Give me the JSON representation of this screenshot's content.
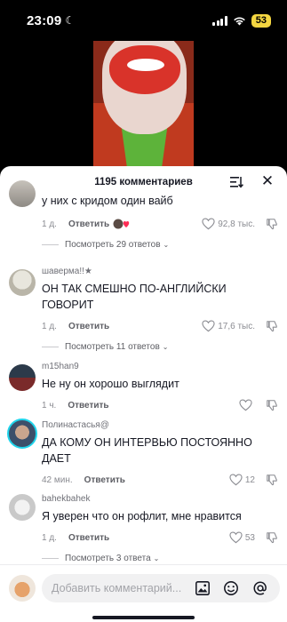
{
  "status_bar": {
    "time": "23:09",
    "battery": "53"
  },
  "sheet": {
    "title": "1195 комментариев"
  },
  "comments": [
    {
      "username": "",
      "text": "у них с кридом один вайб",
      "age": "1 д.",
      "reply_label": "Ответить",
      "likes": "92,8 тыс.",
      "view_replies": "Посмотреть 29 ответов"
    },
    {
      "username": "шаверма!!★",
      "text": "ОН ТАК СМЕШНО ПО-АНГЛИЙСКИ ГОВОРИТ",
      "age": "1 д.",
      "reply_label": "Ответить",
      "likes": "17,6 тыс.",
      "view_replies": "Посмотреть 11 ответов"
    },
    {
      "username": "m15han9",
      "text": "Не ну он хорошо выглядит",
      "age": "1 ч.",
      "reply_label": "Ответить",
      "likes": ""
    },
    {
      "username": "Полинастасья@",
      "text": "ДА КОМУ ОН ИНТЕРВЬЮ ПОСТОЯННО ДАЕТ",
      "age": "42 мин.",
      "reply_label": "Ответить",
      "likes": "12"
    },
    {
      "username": "bahekbahek",
      "text": "Я уверен что он рофлит, мне нравится",
      "age": "1 д.",
      "reply_label": "Ответить",
      "likes": "53",
      "view_replies": "Посмотреть 3 ответа"
    }
  ],
  "composer": {
    "placeholder": "Добавить комментарий..."
  },
  "colors": {
    "sheet_bg": "#ffffff",
    "meta_text": "#8a8b91",
    "battery": "#f4d641"
  },
  "icons": [
    "moon-icon",
    "signal-icon",
    "wifi-icon",
    "sort-icon",
    "close-icon",
    "heart-icon",
    "dislike-icon",
    "image-icon",
    "emoji-icon",
    "mention-icon"
  ]
}
